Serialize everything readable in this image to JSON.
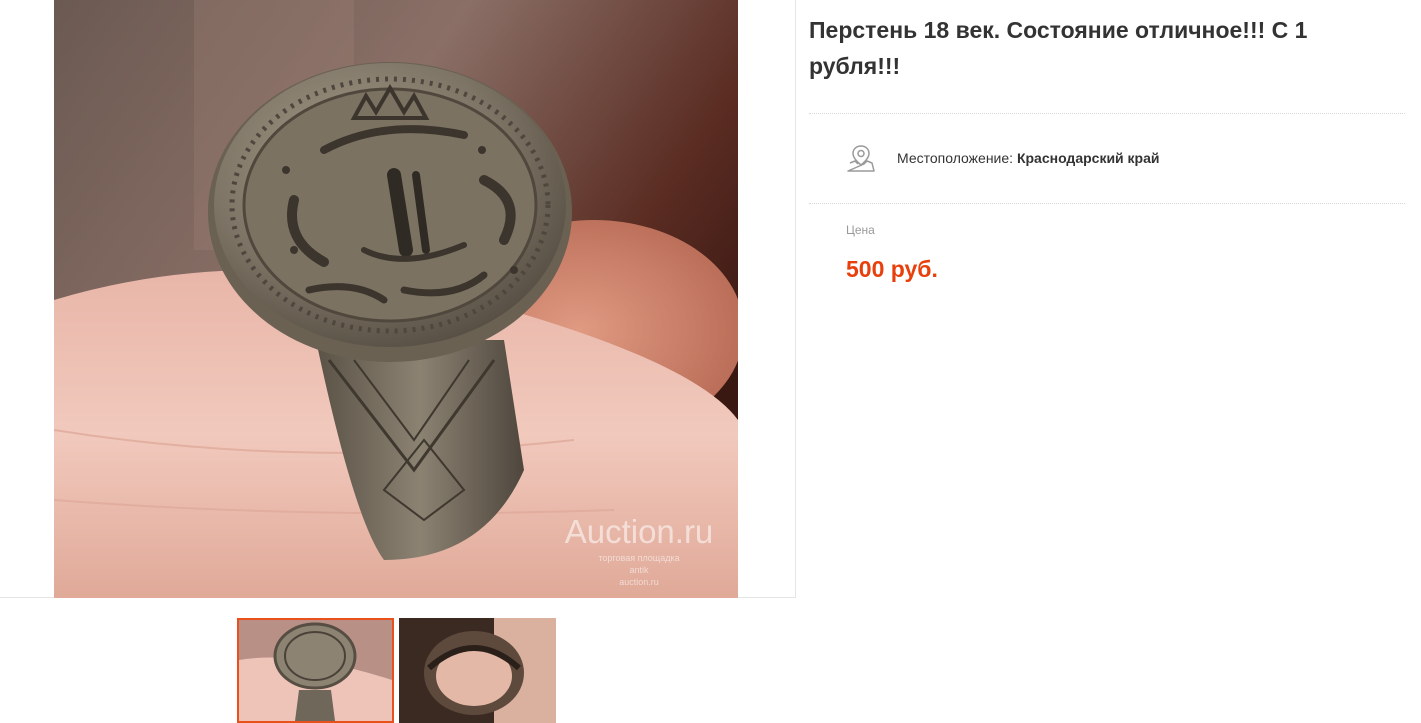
{
  "lot": {
    "title": "Перстень 18 век. Состояние отличное!!! С 1 рубля!!!"
  },
  "gallery": {
    "main_image_alt": "Перстень 18 век",
    "watermark": {
      "brand": "Auction.ru",
      "line1": "торговая площадка",
      "line2": "antik",
      "line3": "auction.ru"
    },
    "thumbnails": [
      {
        "label": "photo 1",
        "active": true
      },
      {
        "label": "photo 2",
        "active": false
      }
    ]
  },
  "location": {
    "label": "Местоположение:",
    "value": "Краснодарский край",
    "icon": "map-pin-icon"
  },
  "price": {
    "label": "Цена",
    "value": "500 руб.",
    "color": "#e8400c"
  },
  "colors": {
    "accent": "#e8501e",
    "text": "#333333",
    "muted": "#999999"
  }
}
